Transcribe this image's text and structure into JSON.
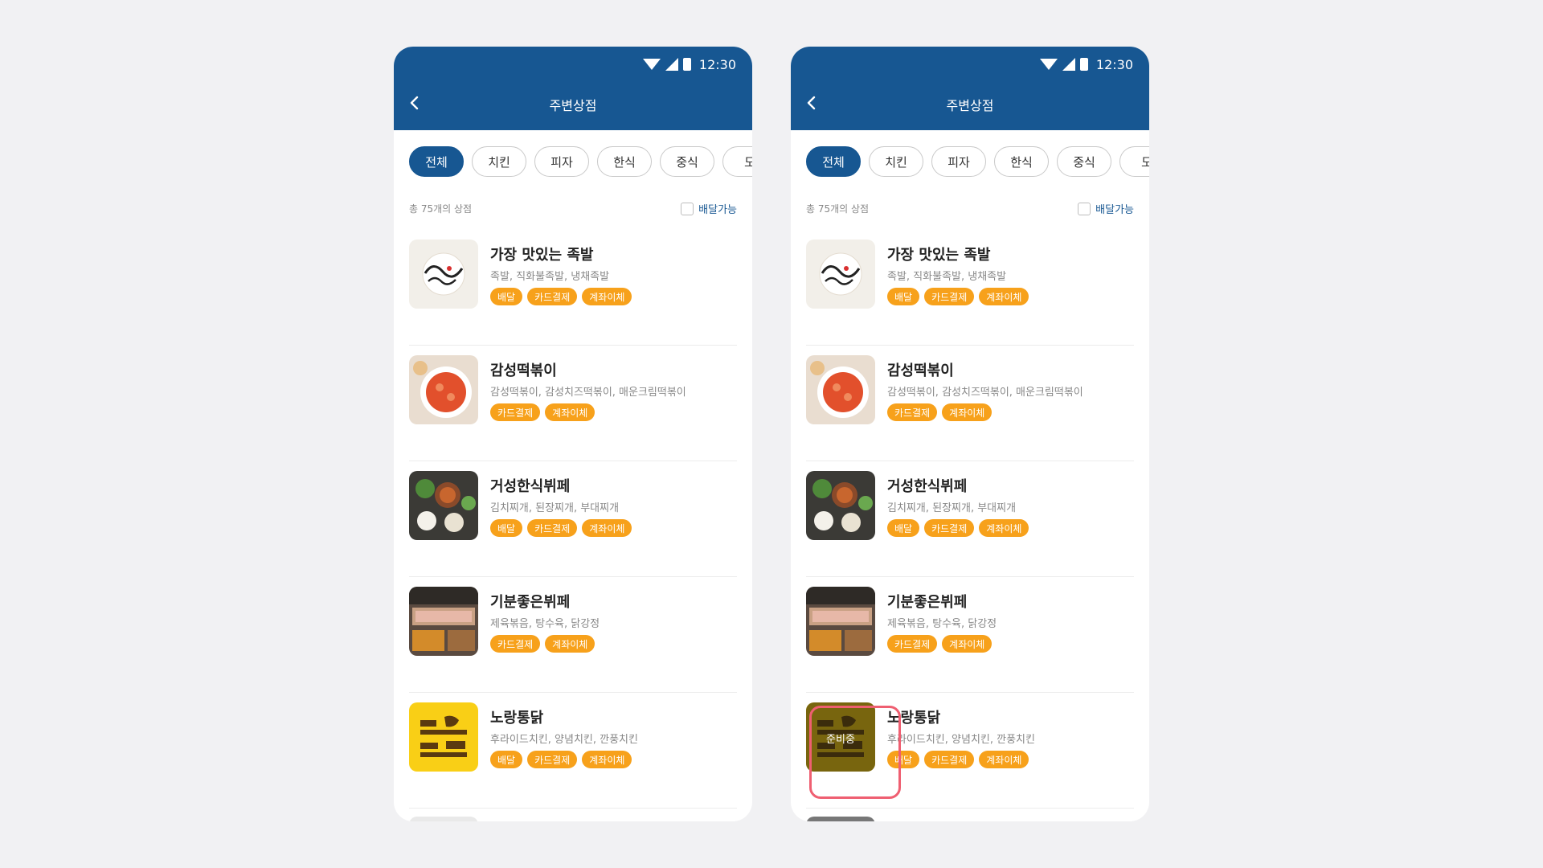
{
  "status_bar": {
    "time": "12:30"
  },
  "app_bar": {
    "title": "주변상점"
  },
  "categories": [
    "전체",
    "치킨",
    "피자",
    "한식",
    "중식",
    "도"
  ],
  "summary": {
    "count_text": "총 75개의 상점",
    "delivery_filter_label": "배달가능"
  },
  "stores": [
    {
      "name": "가장 맛있는 족발",
      "menu": "족발, 직화불족발, 냉채족발",
      "tags": [
        "배달",
        "카드결제",
        "계좌이체"
      ],
      "thumb_icon": "jokbal-logo-icon"
    },
    {
      "name": "감성떡볶이",
      "menu": "감성떡볶이, 감성치즈떡볶이, 매운크림떡볶이",
      "tags": [
        "카드결제",
        "계좌이체"
      ],
      "thumb_icon": "tteokbokki-photo-icon"
    },
    {
      "name": "거성한식뷔페",
      "menu": "김치찌개, 된장찌개, 부대찌개",
      "tags": [
        "배달",
        "카드결제",
        "계좌이체"
      ],
      "thumb_icon": "korean-buffet-photo-icon"
    },
    {
      "name": "기분좋은뷔페",
      "menu": "제육볶음, 탕수육, 닭강정",
      "tags": [
        "카드결제",
        "계좌이체"
      ],
      "thumb_icon": "buffet-photo-icon"
    },
    {
      "name": "노랑통닭",
      "menu": "후라이드치킨, 양념치킨, 깐풍치킨",
      "tags": [
        "배달",
        "카드결제",
        "계좌이체"
      ],
      "thumb_icon": "norang-chicken-logo-icon"
    }
  ],
  "preparing_overlay": {
    "label": "준비중",
    "store_index": 4
  },
  "colors": {
    "primary": "#175792",
    "tag": "#f7a11b",
    "highlight": "#ef5f71",
    "background": "#f1f1f3"
  }
}
